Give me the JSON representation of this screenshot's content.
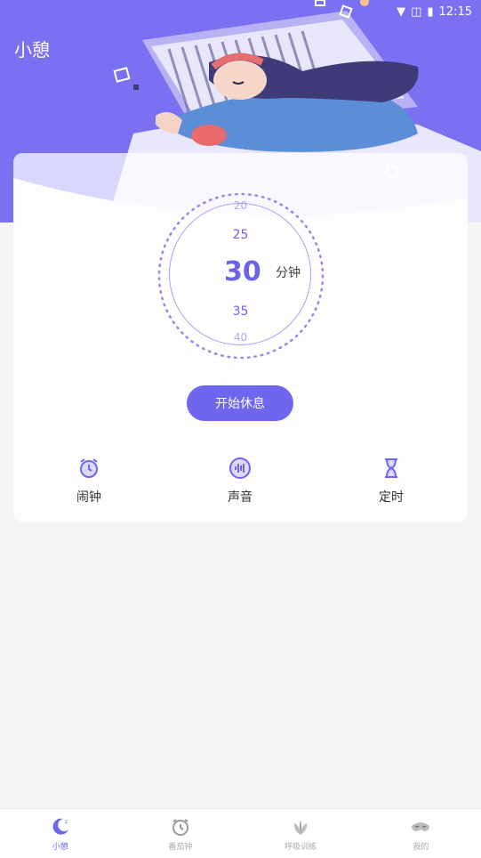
{
  "status_bar": {
    "time": "12:15"
  },
  "app": {
    "title": "小憩"
  },
  "timer": {
    "ticks": [
      "20",
      "25",
      "35",
      "40"
    ],
    "value": "30",
    "unit": "分钟"
  },
  "actions": {
    "start_label": "开始休息"
  },
  "features": [
    {
      "label": "闹钟",
      "icon": "alarm-clock-icon"
    },
    {
      "label": "声音",
      "icon": "sound-wave-icon"
    },
    {
      "label": "定时",
      "icon": "hourglass-icon"
    }
  ],
  "tabbar": {
    "items": [
      {
        "label": "小憩",
        "icon": "moon-icon",
        "active": true
      },
      {
        "label": "番茄钟",
        "icon": "clock-icon",
        "active": false
      },
      {
        "label": "呼吸训练",
        "icon": "leaf-icon",
        "active": false
      },
      {
        "label": "我的",
        "icon": "sleep-mask-icon",
        "active": false
      }
    ]
  },
  "colors": {
    "accent": "#6e66ee",
    "hero_bg": "#7b6ff2"
  }
}
